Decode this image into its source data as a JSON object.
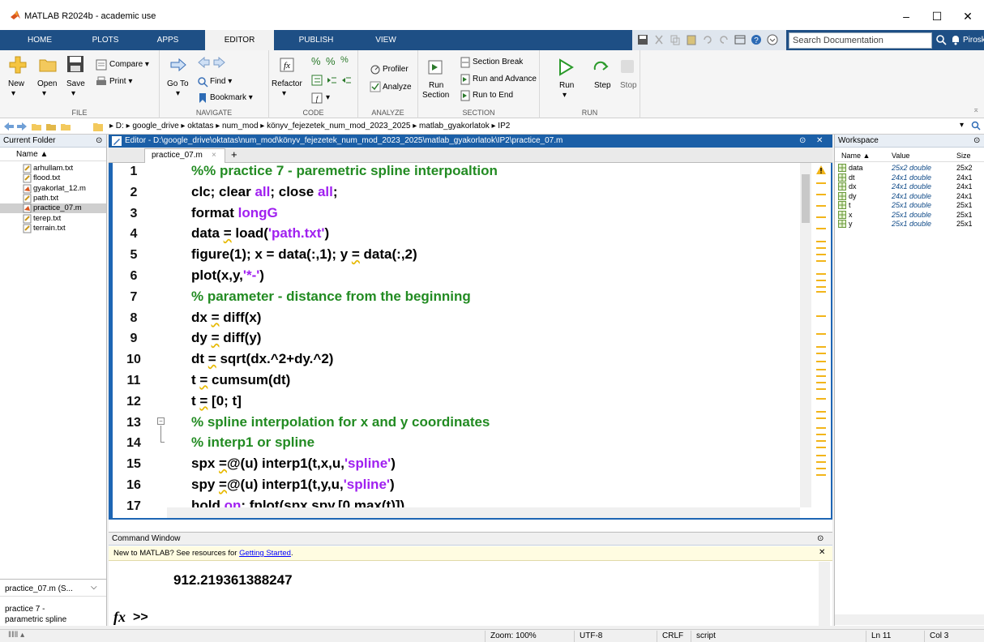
{
  "window": {
    "title": "MATLAB R2024b - academic use",
    "minimize": "–",
    "maximize": "☐",
    "close": "✕"
  },
  "tabs": [
    "HOME",
    "PLOTS",
    "APPS",
    "EDITOR",
    "PUBLISH",
    "VIEW"
  ],
  "search": {
    "placeholder": "Search Documentation"
  },
  "user": "Piroska ▾",
  "ribbon": {
    "file": {
      "new": "New",
      "open": "Open",
      "save": "Save",
      "compare": "Compare ▾",
      "print": "Print ▾",
      "label": "FILE"
    },
    "navigate": {
      "goto": "Go To",
      "find": "Find ▾",
      "bookmark": "Bookmark ▾",
      "label": "NAVIGATE"
    },
    "code": {
      "refactor": "Refactor",
      "label": "CODE"
    },
    "analyze": {
      "profiler": "Profiler",
      "analyze": "Analyze",
      "label": "ANALYZE"
    },
    "section": {
      "run_section_1": "Run",
      "run_section_2": "Section",
      "section_break": "Section Break",
      "run_advance": "Run and Advance",
      "run_end": "Run to End",
      "label": "SECTION"
    },
    "run": {
      "run": "Run",
      "step": "Step",
      "stop": "Stop",
      "label": "RUN"
    }
  },
  "address": {
    "path": "▸ D: ▸ google_drive ▸ oktatas ▸ num_mod ▸ könyv_fejezetek_num_mod_2023_2025 ▸ matlab_gyakorlatok ▸ IP2"
  },
  "current_folder": {
    "title": "Current Folder",
    "col_name": "Name ▲",
    "files": [
      "arhullam.txt",
      "flood.txt",
      "gyakorlat_12.m",
      "path.txt",
      "practice_07.m",
      "terep.txt",
      "terrain.txt"
    ],
    "selected_index": 4,
    "details_title": "practice_07.m (S...",
    "details_text_1": "practice 7 -",
    "details_text_2": "parametric spline"
  },
  "editor": {
    "title": "Editor - D:\\google_drive\\oktatas\\num_mod\\könyv_fejezetek_num_mod_2023_2025\\matlab_gyakorlatok\\IP2\\practice_07.m",
    "tab": "practice_07.m",
    "tab_close": "×",
    "tab_add": "+",
    "line_numbers": [
      "1",
      "2",
      "3",
      "4",
      "5",
      "6",
      "7",
      "8",
      "9",
      "10",
      "11",
      "12",
      "13",
      "14",
      "15",
      "16",
      "17"
    ]
  },
  "command_window": {
    "title": "Command Window",
    "banner_prefix": "New to MATLAB? See resources for ",
    "banner_link": "Getting Started",
    "banner_suffix": ".",
    "output": "912.219361388247",
    "prompt": ">>"
  },
  "workspace": {
    "title": "Workspace",
    "headers": [
      "Name ▲",
      "Value",
      "Size"
    ],
    "rows": [
      {
        "name": "data",
        "value": "25x2 double",
        "size": "25x2"
      },
      {
        "name": "dt",
        "value": "24x1 double",
        "size": "24x1"
      },
      {
        "name": "dx",
        "value": "24x1 double",
        "size": "24x1"
      },
      {
        "name": "dy",
        "value": "24x1 double",
        "size": "24x1"
      },
      {
        "name": "t",
        "value": "25x1 double",
        "size": "25x1"
      },
      {
        "name": "x",
        "value": "25x1 double",
        "size": "25x1"
      },
      {
        "name": "y",
        "value": "25x1 double",
        "size": "25x1"
      }
    ]
  },
  "status": {
    "zoom": "Zoom: 100%",
    "encoding": "UTF-8",
    "eol": "CRLF",
    "type": "script",
    "ln": "Ln  11",
    "col": "Col  3"
  },
  "colors": {
    "tabbar": "#1e4f85",
    "editor_border": "#1e66b4",
    "comment": "#228b22",
    "string": "#a020f0",
    "keyword": "#0000ff"
  }
}
